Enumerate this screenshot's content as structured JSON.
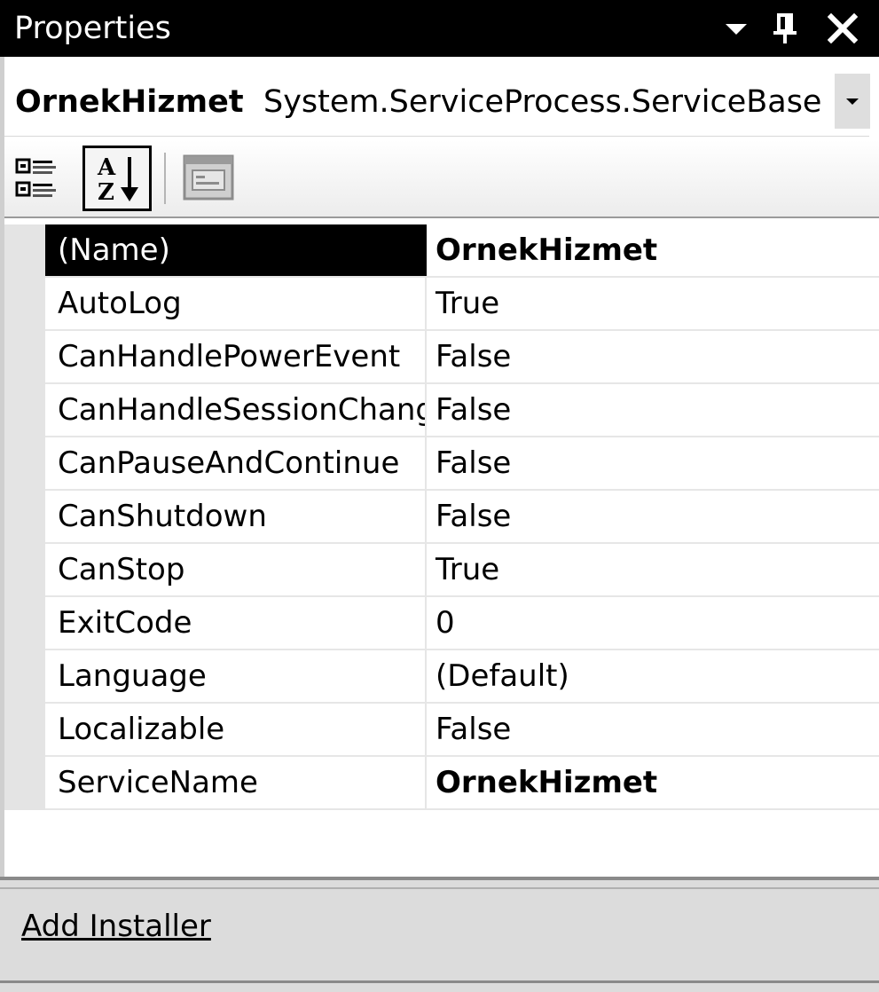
{
  "window": {
    "title": "Properties",
    "dropdown_icon": "chevron-down-icon",
    "pin_icon": "pin-icon",
    "close_icon": "close-icon"
  },
  "object_selector": {
    "name": "OrnekHizmet",
    "type": "System.ServiceProcess.ServiceBase"
  },
  "toolbar": {
    "categorized_icon": "categorized-icon",
    "alphabetical_icon": "alphabetical-sort-icon",
    "alphabetical_active": true,
    "property_pages_icon": "property-pages-icon"
  },
  "properties": [
    {
      "name": "(Name)",
      "value": "OrnekHizmet",
      "bold": true,
      "selected": true
    },
    {
      "name": "AutoLog",
      "value": "True",
      "bold": false,
      "selected": false
    },
    {
      "name": "CanHandlePowerEvent",
      "value": "False",
      "bold": false,
      "selected": false
    },
    {
      "name": "CanHandleSessionChangeEvent",
      "value": "False",
      "bold": false,
      "selected": false
    },
    {
      "name": "CanPauseAndContinue",
      "value": "False",
      "bold": false,
      "selected": false
    },
    {
      "name": "CanShutdown",
      "value": "False",
      "bold": false,
      "selected": false
    },
    {
      "name": "CanStop",
      "value": "True",
      "bold": false,
      "selected": false
    },
    {
      "name": "ExitCode",
      "value": "0",
      "bold": false,
      "selected": false
    },
    {
      "name": "Language",
      "value": "(Default)",
      "bold": false,
      "selected": false
    },
    {
      "name": "Localizable",
      "value": "False",
      "bold": false,
      "selected": false
    },
    {
      "name": "ServiceName",
      "value": "OrnekHizmet",
      "bold": true,
      "selected": false
    }
  ],
  "commands": {
    "add_installer": "Add Installer"
  }
}
